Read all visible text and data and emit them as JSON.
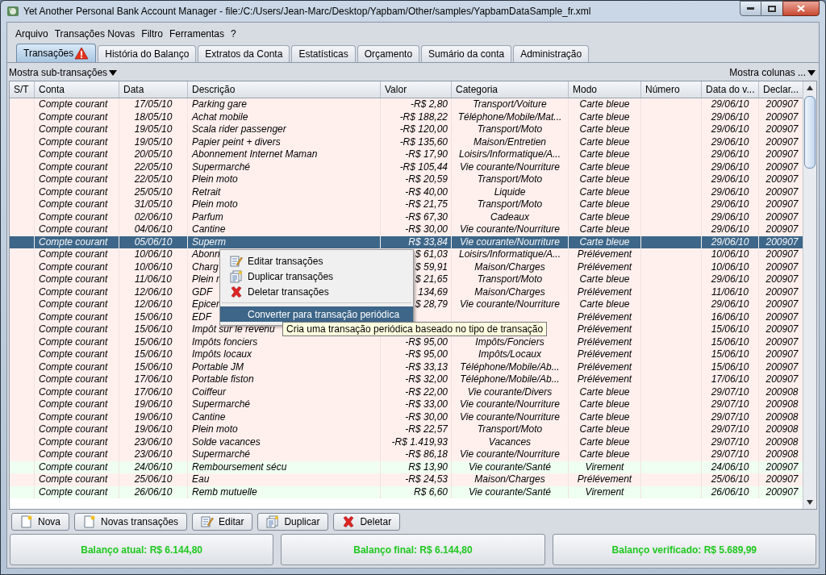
{
  "window": {
    "title": "Yet Another Personal Bank Account Manager - file:/C:/Users/Jean-Marc/Desktop/Yapbam/Other/samples/YapbamDataSample_fr.xml"
  },
  "menu": [
    "Arquivo",
    "Transações Novas",
    "Filtro",
    "Ferramentas",
    "?"
  ],
  "tabs": [
    {
      "label": "Transações",
      "selected": true,
      "warning": true
    },
    {
      "label": "História do Balanço",
      "selected": false,
      "warning": false
    },
    {
      "label": "Extratos da Conta",
      "selected": false,
      "warning": false
    },
    {
      "label": "Estatísticas",
      "selected": false,
      "warning": false
    },
    {
      "label": "Orçamento",
      "selected": false,
      "warning": false
    },
    {
      "label": "Sumário da conta",
      "selected": false,
      "warning": false
    },
    {
      "label": "Administração",
      "selected": false,
      "warning": false
    }
  ],
  "subtransactions_toggle": "Mostra sub-transações",
  "columns_toggle": "Mostra colunas ...",
  "table": {
    "columns": [
      "S/T",
      "Conta",
      "Data",
      "Descrição",
      "Valor",
      "Categoria",
      "Modo",
      "Número",
      "Data do v...",
      "Declar..."
    ],
    "rows": [
      {
        "kind": "debit",
        "selected": false,
        "account": "Compte courant",
        "date": "17/05/10",
        "description": "Parking gare",
        "amount": "-R$ 2,80",
        "category": "Transport/Voiture",
        "mode": "Carte bleue",
        "value_date": "29/06/10",
        "statement": "200907"
      },
      {
        "kind": "debit",
        "selected": false,
        "account": "Compte courant",
        "date": "18/05/10",
        "description": "Achat mobile",
        "amount": "-R$ 188,22",
        "category": "Téléphone/Mobile/Mat...",
        "mode": "Carte bleue",
        "value_date": "29/06/10",
        "statement": "200907"
      },
      {
        "kind": "debit",
        "selected": false,
        "account": "Compte courant",
        "date": "19/05/10",
        "description": "Scala rider passenger",
        "amount": "-R$ 120,00",
        "category": "Transport/Moto",
        "mode": "Carte bleue",
        "value_date": "29/06/10",
        "statement": "200907"
      },
      {
        "kind": "debit",
        "selected": false,
        "account": "Compte courant",
        "date": "19/05/10",
        "description": "Papier peint + divers",
        "amount": "-R$ 135,60",
        "category": "Maison/Entretien",
        "mode": "Carte bleue",
        "value_date": "29/06/10",
        "statement": "200907"
      },
      {
        "kind": "debit",
        "selected": false,
        "account": "Compte courant",
        "date": "20/05/10",
        "description": "Abonnement Internet Maman",
        "amount": "-R$ 17,90",
        "category": "Loisirs/Informatique/A...",
        "mode": "Carte bleue",
        "value_date": "29/06/10",
        "statement": "200907"
      },
      {
        "kind": "debit",
        "selected": false,
        "account": "Compte courant",
        "date": "22/05/10",
        "description": "Supermarché",
        "amount": "-R$ 105,44",
        "category": "Vie courante/Nourriture",
        "mode": "Carte bleue",
        "value_date": "29/06/10",
        "statement": "200907"
      },
      {
        "kind": "debit",
        "selected": false,
        "account": "Compte courant",
        "date": "22/05/10",
        "description": "Plein moto",
        "amount": "-R$ 20,59",
        "category": "Transport/Moto",
        "mode": "Carte bleue",
        "value_date": "29/06/10",
        "statement": "200907"
      },
      {
        "kind": "debit",
        "selected": false,
        "account": "Compte courant",
        "date": "25/05/10",
        "description": "Retrait",
        "amount": "-R$ 40,00",
        "category": "Liquide",
        "mode": "Carte bleue",
        "value_date": "29/06/10",
        "statement": "200907"
      },
      {
        "kind": "debit",
        "selected": false,
        "account": "Compte courant",
        "date": "31/05/10",
        "description": "Plein moto",
        "amount": "-R$ 21,75",
        "category": "Transport/Moto",
        "mode": "Carte bleue",
        "value_date": "29/06/10",
        "statement": "200907"
      },
      {
        "kind": "debit",
        "selected": false,
        "account": "Compte courant",
        "date": "02/06/10",
        "description": "Parfum",
        "amount": "-R$ 67,30",
        "category": "Cadeaux",
        "mode": "Carte bleue",
        "value_date": "29/06/10",
        "statement": "200907"
      },
      {
        "kind": "debit",
        "selected": false,
        "account": "Compte courant",
        "date": "04/06/10",
        "description": "Cantine",
        "amount": "-R$ 30,00",
        "category": "Vie courante/Nourriture",
        "mode": "Carte bleue",
        "value_date": "29/06/10",
        "statement": "200907"
      },
      {
        "kind": "debit",
        "selected": true,
        "account": "Compte courant",
        "date": "05/06/10",
        "description": "Superm",
        "amount": "R$ 33,84",
        "category": "Vie courante/Nourriture",
        "mode": "Carte bleue",
        "value_date": "29/06/10",
        "statement": "200907"
      },
      {
        "kind": "debit",
        "selected": false,
        "account": "Compte courant",
        "date": "10/06/10",
        "description": "Abonn",
        "amount": "$ 61,03",
        "category": "Loisirs/Informatique/A...",
        "mode": "Prélévement",
        "value_date": "10/06/10",
        "statement": "200907"
      },
      {
        "kind": "debit",
        "selected": false,
        "account": "Compte courant",
        "date": "10/06/10",
        "description": "Charg",
        "amount": "$ 59,91",
        "category": "Maison/Charges",
        "mode": "Prélévement",
        "value_date": "10/06/10",
        "statement": "200907"
      },
      {
        "kind": "debit",
        "selected": false,
        "account": "Compte courant",
        "date": "11/06/10",
        "description": "Plein r",
        "amount": "$ 21,65",
        "category": "Transport/Moto",
        "mode": "Carte bleue",
        "value_date": "29/06/10",
        "statement": "200907"
      },
      {
        "kind": "debit",
        "selected": false,
        "account": "Compte courant",
        "date": "12/06/10",
        "description": "GDF",
        "amount": "134,69",
        "category": "Maison/Charges",
        "mode": "Prélévement",
        "value_date": "11/06/10",
        "statement": "200907"
      },
      {
        "kind": "debit",
        "selected": false,
        "account": "Compte courant",
        "date": "12/06/10",
        "description": "Epicer",
        "amount": "$ 28,79",
        "category": "Vie courante/Nourriture",
        "mode": "Carte bleue",
        "value_date": "29/06/10",
        "statement": "200907"
      },
      {
        "kind": "debit",
        "selected": false,
        "account": "Compte courant",
        "date": "15/06/10",
        "description": "EDF",
        "mode": "Prélévement",
        "value_date": "16/06/10",
        "statement": "200907"
      },
      {
        "kind": "debit",
        "selected": false,
        "account": "Compte courant",
        "date": "15/06/10",
        "description": "Impôt sur le revenu",
        "mode": "Prélévement",
        "value_date": "15/06/10",
        "statement": "200907"
      },
      {
        "kind": "debit",
        "selected": false,
        "account": "Compte courant",
        "date": "15/06/10",
        "description": "Impôts fonciers",
        "amount": "-R$ 95,00",
        "category": "Impôts/Fonciers",
        "mode": "Prélévement",
        "value_date": "15/06/10",
        "statement": "200907"
      },
      {
        "kind": "debit",
        "selected": false,
        "account": "Compte courant",
        "date": "15/06/10",
        "description": "Impôts locaux",
        "amount": "-R$ 95,00",
        "category": "Impôts/Locaux",
        "mode": "Prélévement",
        "value_date": "15/06/10",
        "statement": "200907"
      },
      {
        "kind": "debit",
        "selected": false,
        "account": "Compte courant",
        "date": "15/06/10",
        "description": "Portable JM",
        "amount": "-R$ 33,13",
        "category": "Téléphone/Mobile/Ab...",
        "mode": "Prélévement",
        "value_date": "15/06/10",
        "statement": "200907"
      },
      {
        "kind": "debit",
        "selected": false,
        "account": "Compte courant",
        "date": "17/06/10",
        "description": "Portable fiston",
        "amount": "-R$ 32,00",
        "category": "Téléphone/Mobile/Ab...",
        "mode": "Prélévement",
        "value_date": "17/06/10",
        "statement": "200907"
      },
      {
        "kind": "debit",
        "selected": false,
        "account": "Compte courant",
        "date": "17/06/10",
        "description": "Coiffeur",
        "amount": "-R$ 22,00",
        "category": "Vie courante/Divers",
        "mode": "Carte bleue",
        "value_date": "29/07/10",
        "statement": "200908"
      },
      {
        "kind": "debit",
        "selected": false,
        "account": "Compte courant",
        "date": "19/06/10",
        "description": "Supermarché",
        "amount": "-R$ 33,00",
        "category": "Vie courante/Nourriture",
        "mode": "Carte bleue",
        "value_date": "29/07/10",
        "statement": "200908"
      },
      {
        "kind": "debit",
        "selected": false,
        "account": "Compte courant",
        "date": "19/06/10",
        "description": "Cantine",
        "amount": "-R$ 30,00",
        "category": "Vie courante/Nourriture",
        "mode": "Carte bleue",
        "value_date": "29/07/10",
        "statement": "200908"
      },
      {
        "kind": "debit",
        "selected": false,
        "account": "Compte courant",
        "date": "19/06/10",
        "description": "Plein moto",
        "amount": "-R$ 22,57",
        "category": "Transport/Moto",
        "mode": "Carte bleue",
        "value_date": "29/07/10",
        "statement": "200908"
      },
      {
        "kind": "debit",
        "selected": false,
        "account": "Compte courant",
        "date": "23/06/10",
        "description": "Solde vacances",
        "amount": "-R$ 1.419,93",
        "category": "Vacances",
        "mode": "Carte bleue",
        "value_date": "29/07/10",
        "statement": "200908"
      },
      {
        "kind": "debit",
        "selected": false,
        "account": "Compte courant",
        "date": "23/06/10",
        "description": "Supermarché",
        "amount": "-R$ 86,18",
        "category": "Vie courante/Nourriture",
        "mode": "Carte bleue",
        "value_date": "29/07/10",
        "statement": "200908"
      },
      {
        "kind": "credit",
        "selected": false,
        "account": "Compte courant",
        "date": "24/06/10",
        "description": "Remboursement sécu",
        "amount": "R$ 13,90",
        "category": "Vie courante/Santé",
        "mode": "Virement",
        "value_date": "24/06/10",
        "statement": "200907"
      },
      {
        "kind": "debit",
        "selected": false,
        "account": "Compte courant",
        "date": "25/06/10",
        "description": "Eau",
        "amount": "-R$ 24,53",
        "category": "Maison/Charges",
        "mode": "Prélévement",
        "value_date": "25/06/10",
        "statement": "200907"
      },
      {
        "kind": "credit",
        "selected": false,
        "account": "Compte courant",
        "date": "26/06/10",
        "description": "Remb mutuelle",
        "amount": "R$ 6,60",
        "category": "Vie courante/Santé",
        "mode": "Virement",
        "value_date": "26/06/10",
        "statement": "200907"
      }
    ]
  },
  "context_menu": [
    {
      "kind": "edit",
      "label": "Editar transações",
      "selected": false
    },
    {
      "kind": "duplicate",
      "label": "Duplicar transações",
      "selected": false
    },
    {
      "kind": "delete",
      "label": "Deletar transações",
      "selected": false
    },
    {
      "kind": "plain",
      "label": "Converter para transação periódica",
      "selected": true
    }
  ],
  "tooltip": "Cria uma transação periódica baseado no tipo de transação",
  "buttons": [
    {
      "kind": "new",
      "label": "Nova"
    },
    {
      "kind": "new",
      "label": "Novas transações"
    },
    {
      "kind": "edit",
      "label": "Editar"
    },
    {
      "kind": "duplicate",
      "label": "Duplicar"
    },
    {
      "kind": "delete",
      "label": "Deletar"
    }
  ],
  "balances": [
    "Balanço atual: R$ 6.144,80",
    "Balanço final: R$ 6.144,80",
    "Balanço verificado: R$ 5.689,99"
  ]
}
